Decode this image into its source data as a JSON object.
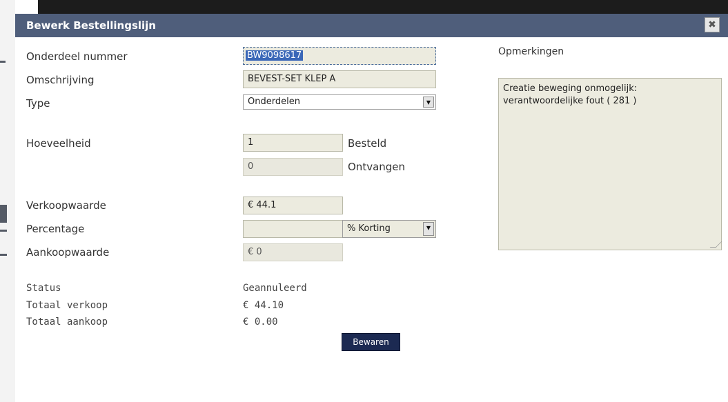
{
  "dialog": {
    "title": "Bewerk Bestellingslijn",
    "close_icon": "close-icon"
  },
  "form": {
    "part_number": {
      "label": "Onderdeel nummer",
      "value": "BW9098617"
    },
    "description": {
      "label": "Omschrijving",
      "value": "BEVEST-SET KLEP A"
    },
    "type": {
      "label": "Type",
      "value": "Onderdelen"
    },
    "quantity": {
      "label": "Hoeveelheid",
      "ordered_value": "1",
      "ordered_label": "Besteld",
      "received_value": "0",
      "received_label": "Ontvangen"
    },
    "sale_value": {
      "label": "Verkoopwaarde",
      "value": "€ 44.1"
    },
    "percentage": {
      "label": "Percentage",
      "value": "",
      "mode": "% Korting"
    },
    "purchase_value": {
      "label": "Aankoopwaarde",
      "value": "€ 0"
    }
  },
  "remarks": {
    "label": "Opmerkingen",
    "value": "Creatie beweging onmogelijk: verantwoordelijke fout ( 281 )"
  },
  "summary": {
    "status_label": "Status",
    "status_value": "Geannuleerd",
    "total_sale_label": "Totaal verkoop",
    "total_sale_value": "€ 44.10",
    "total_purchase_label": "Totaal aankoop",
    "total_purchase_value": "€ 0.00"
  },
  "actions": {
    "save_label": "Bewaren"
  },
  "colors": {
    "titlebar": "#4f5e7b",
    "field_background": "#ecebdf",
    "save_button": "#1c2a52",
    "selection": "#3a67b8"
  }
}
